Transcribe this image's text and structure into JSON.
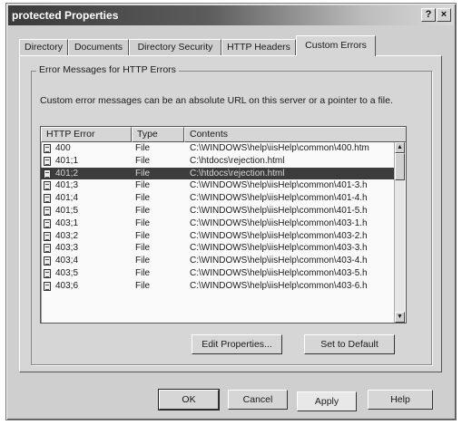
{
  "window": {
    "title": "protected Properties",
    "help_btn": "?",
    "close_btn": "×"
  },
  "tabs": [
    "Directory",
    "Documents",
    "Directory Security",
    "HTTP Headers",
    "Custom Errors"
  ],
  "group": {
    "label": "Error Messages for HTTP Errors",
    "description": "Custom error messages can be an absolute URL on this server or a pointer to a file."
  },
  "list": {
    "columns": [
      "HTTP Error",
      "Type",
      "Contents"
    ],
    "rows": [
      {
        "code": "400",
        "type": "File",
        "contents": "C:\\WINDOWS\\help\\iisHelp\\common\\400.htm"
      },
      {
        "code": "401;1",
        "type": "File",
        "contents": "C:\\htdocs\\rejection.html"
      },
      {
        "code": "401;2",
        "type": "File",
        "contents": "C:\\htdocs\\rejection.html"
      },
      {
        "code": "401;3",
        "type": "File",
        "contents": "C:\\WINDOWS\\help\\iisHelp\\common\\401-3.h"
      },
      {
        "code": "401;4",
        "type": "File",
        "contents": "C:\\WINDOWS\\help\\iisHelp\\common\\401-4.h"
      },
      {
        "code": "401;5",
        "type": "File",
        "contents": "C:\\WINDOWS\\help\\iisHelp\\common\\401-5.h"
      },
      {
        "code": "403;1",
        "type": "File",
        "contents": "C:\\WINDOWS\\help\\iisHelp\\common\\403-1.h"
      },
      {
        "code": "403;2",
        "type": "File",
        "contents": "C:\\WINDOWS\\help\\iisHelp\\common\\403-2.h"
      },
      {
        "code": "403;3",
        "type": "File",
        "contents": "C:\\WINDOWS\\help\\iisHelp\\common\\403-3.h"
      },
      {
        "code": "403;4",
        "type": "File",
        "contents": "C:\\WINDOWS\\help\\iisHelp\\common\\403-4.h"
      },
      {
        "code": "403;5",
        "type": "File",
        "contents": "C:\\WINDOWS\\help\\iisHelp\\common\\403-5.h"
      },
      {
        "code": "403;6",
        "type": "File",
        "contents": "C:\\WINDOWS\\help\\iisHelp\\common\\403-6.h"
      }
    ],
    "selected_index": 2
  },
  "panel_buttons": {
    "edit": "Edit Properties...",
    "default": "Set to Default"
  },
  "footer_buttons": {
    "ok": "OK",
    "cancel": "Cancel",
    "apply": "Apply",
    "help": "Help"
  }
}
